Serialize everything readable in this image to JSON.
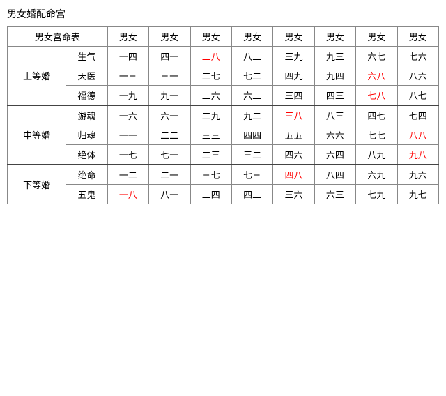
{
  "title": "男女婚配命宫",
  "table": {
    "header": {
      "col0": "男女宫命表",
      "cols": [
        "男女",
        "男女",
        "男女",
        "男女",
        "男女",
        "男女",
        "男女",
        "男女"
      ]
    },
    "groups": [
      {
        "group_label": "上等婚",
        "rows": [
          {
            "row_label": "生气",
            "cells": [
              "一四",
              "四一",
              "二八",
              "八二",
              "三九",
              "九三",
              "六七",
              "七六"
            ],
            "red": [
              2
            ]
          },
          {
            "row_label": "天医",
            "cells": [
              "一三",
              "三一",
              "二七",
              "七二",
              "四九",
              "九四",
              "六八",
              "八六"
            ],
            "red": [
              6
            ]
          },
          {
            "row_label": "福德",
            "cells": [
              "一九",
              "九一",
              "二六",
              "六二",
              "三四",
              "四三",
              "七八",
              "八七"
            ],
            "red": [
              6
            ]
          }
        ]
      },
      {
        "group_label": "中等婚",
        "rows": [
          {
            "row_label": "游魂",
            "cells": [
              "一六",
              "六一",
              "二九",
              "九二",
              "三八",
              "八三",
              "四七",
              "七四"
            ],
            "red": [
              4
            ]
          },
          {
            "row_label": "归魂",
            "cells": [
              "一一",
              "二二",
              "三三",
              "四四",
              "五五",
              "六六",
              "七七",
              "八八"
            ],
            "red": [
              7
            ]
          },
          {
            "row_label": "绝体",
            "cells": [
              "一七",
              "七一",
              "二三",
              "三二",
              "四六",
              "六四",
              "八九",
              "九八"
            ],
            "red": [
              7
            ]
          }
        ]
      },
      {
        "group_label": "下等婚",
        "rows": [
          {
            "row_label": "绝命",
            "cells": [
              "一二",
              "二一",
              "三七",
              "七三",
              "四八",
              "八四",
              "六九",
              "九六"
            ],
            "red": [
              4
            ]
          },
          {
            "row_label": "五鬼",
            "cells": [
              "一八",
              "八一",
              "二四",
              "四二",
              "三六",
              "六三",
              "七九",
              "九七"
            ],
            "red": [
              0
            ]
          }
        ]
      }
    ]
  }
}
